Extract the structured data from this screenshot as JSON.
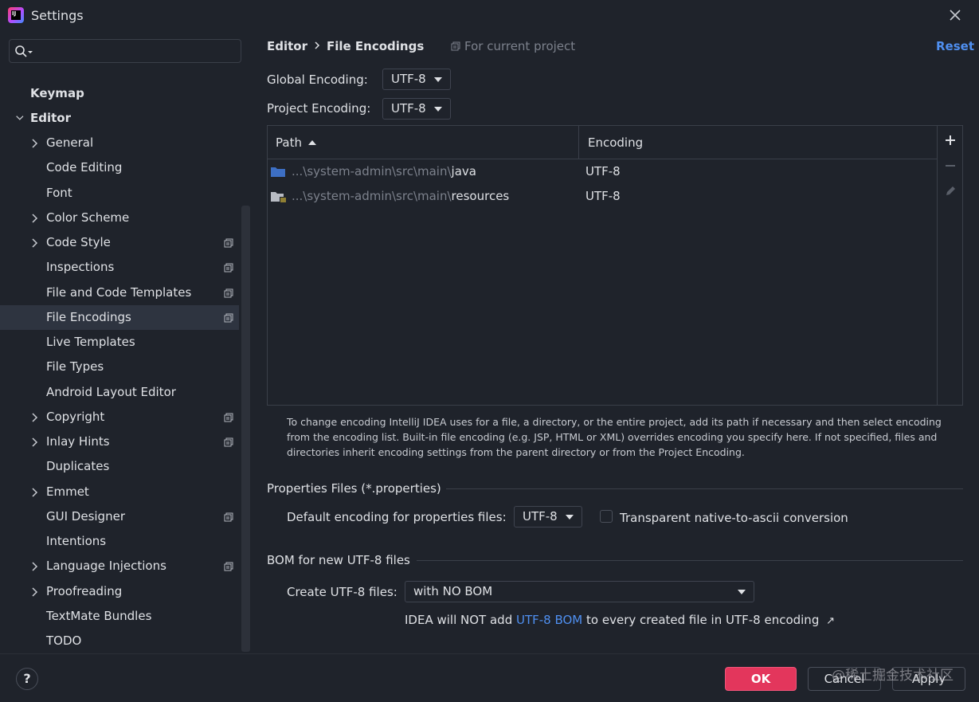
{
  "window": {
    "title": "Settings"
  },
  "search": {
    "placeholder": ""
  },
  "sidebar": {
    "items": [
      {
        "label": "Keymap"
      },
      {
        "label": "Editor"
      },
      {
        "label": "General"
      },
      {
        "label": "Code Editing"
      },
      {
        "label": "Font"
      },
      {
        "label": "Color Scheme"
      },
      {
        "label": "Code Style"
      },
      {
        "label": "Inspections"
      },
      {
        "label": "File and Code Templates"
      },
      {
        "label": "File Encodings"
      },
      {
        "label": "Live Templates"
      },
      {
        "label": "File Types"
      },
      {
        "label": "Android Layout Editor"
      },
      {
        "label": "Copyright"
      },
      {
        "label": "Inlay Hints"
      },
      {
        "label": "Duplicates"
      },
      {
        "label": "Emmet"
      },
      {
        "label": "GUI Designer"
      },
      {
        "label": "Intentions"
      },
      {
        "label": "Language Injections"
      },
      {
        "label": "Proofreading"
      },
      {
        "label": "TextMate Bundles"
      },
      {
        "label": "TODO"
      }
    ]
  },
  "header": {
    "breadcrumb_parent": "Editor",
    "breadcrumb_current": "File Encodings",
    "scope": "For current project",
    "reset": "Reset"
  },
  "encoding": {
    "global_label": "Global Encoding:",
    "global_value": "UTF-8",
    "project_label": "Project Encoding:",
    "project_value": "UTF-8"
  },
  "table": {
    "columns": [
      "Path",
      "Encoding"
    ],
    "rows": [
      {
        "path_prefix": "...\\system-admin\\src\\main\\",
        "path_leaf": "java",
        "encoding": "UTF-8"
      },
      {
        "path_prefix": "...\\system-admin\\src\\main\\",
        "path_leaf": "resources",
        "encoding": "UTF-8"
      }
    ]
  },
  "hint": "To change encoding IntelliJ IDEA uses for a file, a directory, or the entire project, add its path if necessary and then select encoding from the encoding list. Built-in file encoding (e.g. JSP, HTML or XML) overrides encoding you specify here. If not specified, files and directories inherit encoding settings from the parent directory or from the Project Encoding.",
  "properties": {
    "section_title": "Properties Files (*.properties)",
    "default_label": "Default encoding for properties files:",
    "default_value": "UTF-8",
    "transparent_label": "Transparent native-to-ascii conversion"
  },
  "bom": {
    "section_title": "BOM for new UTF-8 files",
    "create_label": "Create UTF-8 files:",
    "create_value": "with NO BOM",
    "note_prefix": "IDEA will NOT add ",
    "note_link": "UTF-8 BOM",
    "note_suffix": " to every created file in UTF-8 encoding",
    "note_arrow": "↗"
  },
  "footer": {
    "help": "?",
    "ok": "OK",
    "cancel": "Cancel",
    "apply": "Apply",
    "watermark": "@稀土掘金技术社区"
  },
  "colors": {
    "accent": "#4f8ff0",
    "ok_button": "#e3365c",
    "background": "#1f232b",
    "selection": "#2e3440"
  }
}
